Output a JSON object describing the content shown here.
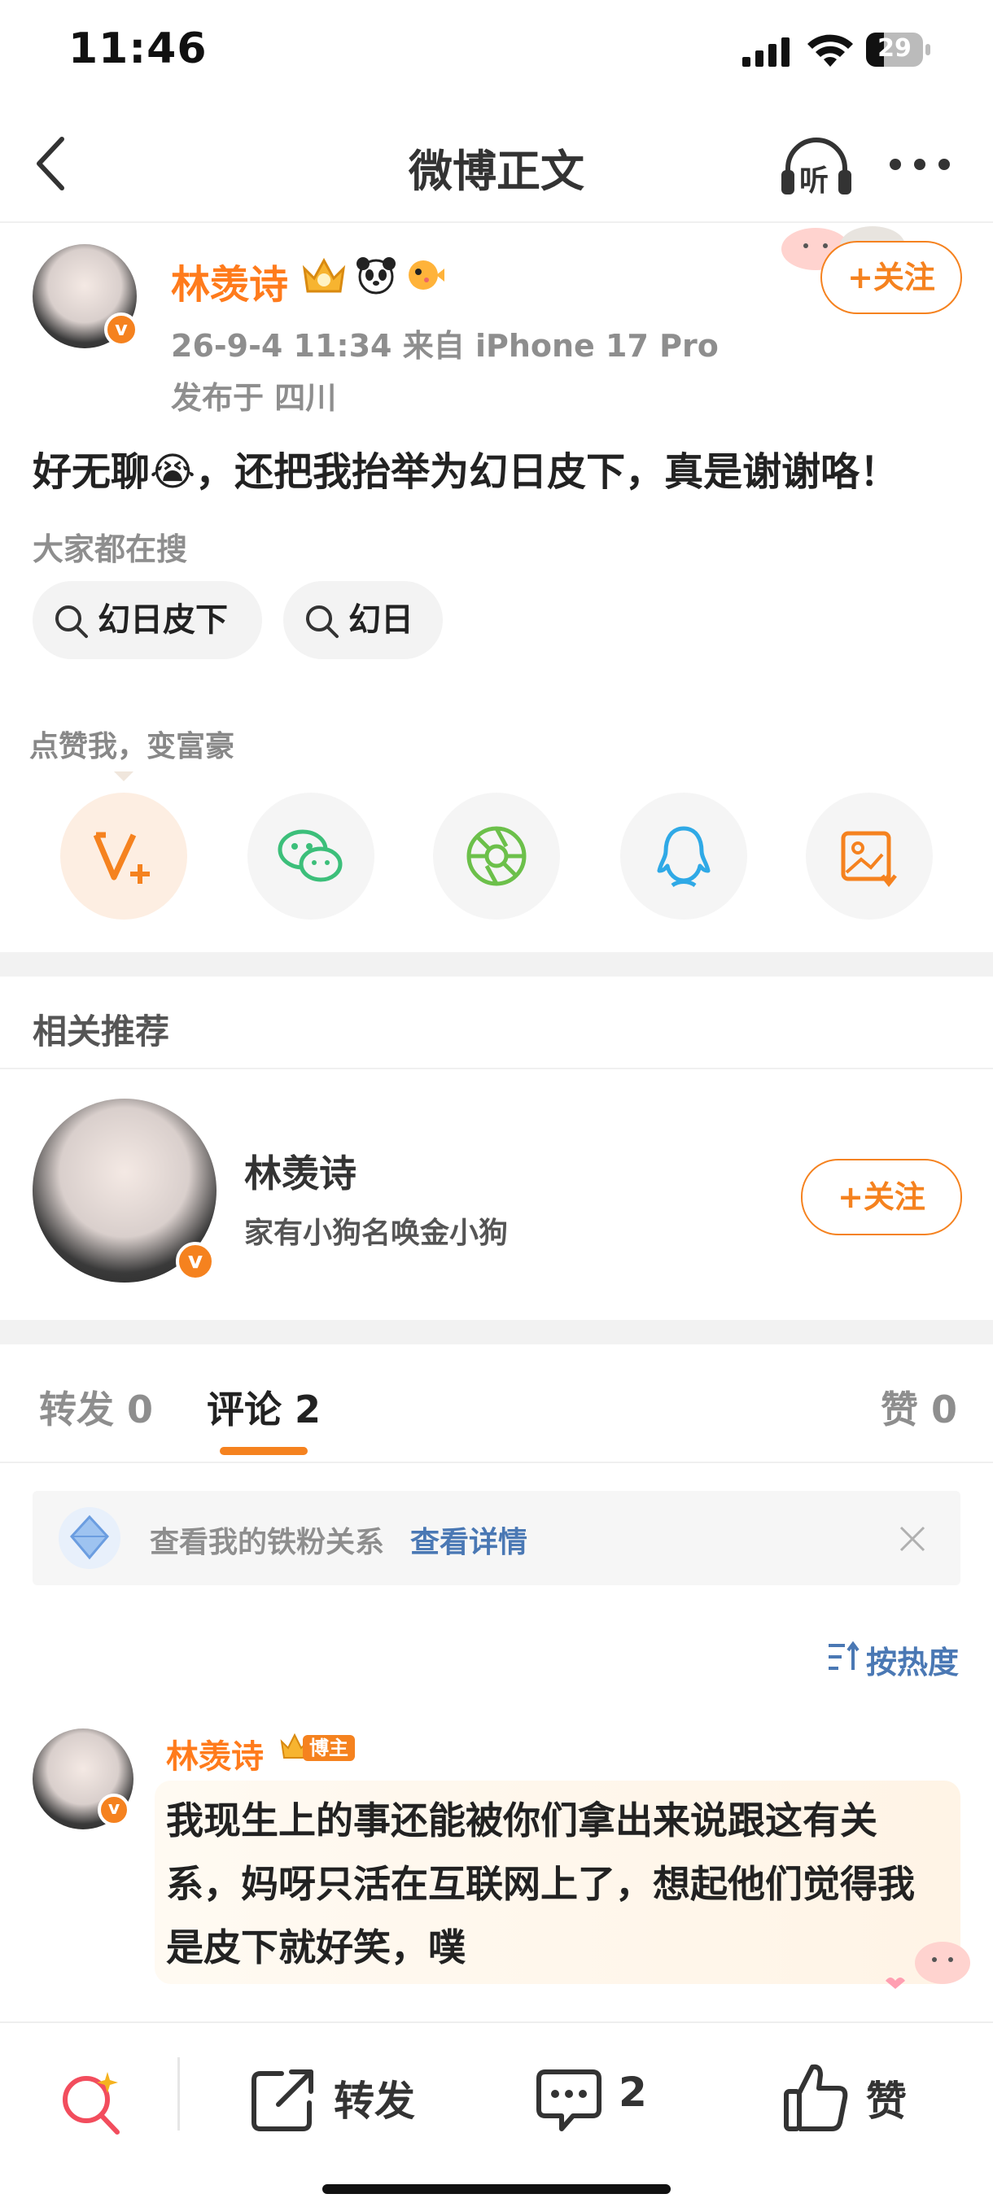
{
  "status": {
    "time": "11:46",
    "battery": "29"
  },
  "nav": {
    "title": "微博正文",
    "listen_label": "听"
  },
  "post": {
    "author": "林羡诗",
    "meta_line": "26-9-4 11:34  来自 iPhone 17 Pro",
    "location": "发布于 四川",
    "follow_label": "+关注",
    "text": "好无聊😭，还把我抬举为幻日皮下，真是谢谢咯！",
    "hot_search_label": "大家都在搜",
    "hot_tags": [
      "幻日皮下",
      "幻日"
    ],
    "like_hint": "点赞我，变富豪",
    "v_badge": "v"
  },
  "recommend": {
    "section_title": "相关推荐",
    "name": "林羡诗",
    "desc": "家有小狗名唤金小狗",
    "follow_label": "+关注"
  },
  "tabs": {
    "repost": "转发 0",
    "comment": "评论 2",
    "like": "赞 0"
  },
  "fan_bar": {
    "text": "查看我的铁粉关系",
    "link": "查看详情"
  },
  "sort_label": "按热度",
  "comment": {
    "author": "林羡诗",
    "badge": "博主",
    "text": "我现生上的事还能被你们拿出来说跟这有关系，妈呀只活在互联网上了，想起他们觉得我是皮下就好笑，噗"
  },
  "bottom": {
    "repost": "转发",
    "comment_count": "2",
    "like": "赞"
  },
  "colors": {
    "accent": "#f5821f",
    "name": "#ff7b1c",
    "link": "#4a78b4",
    "wechat": "#3cbf7a",
    "qq": "#2fa9e6"
  }
}
